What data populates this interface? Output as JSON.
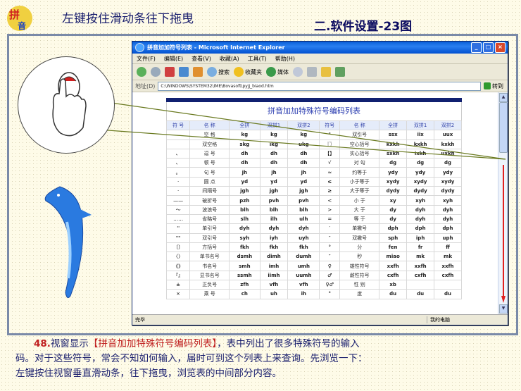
{
  "header": {
    "logo_text": "拼音",
    "left_title": "左键按住滑动条往下拖曳",
    "section_title": "二.软件设置-23图"
  },
  "window": {
    "title": "拼音加加符号列表 - Microsoft Internet Explorer",
    "menu": [
      "文件(F)",
      "编辑(E)",
      "查看(V)",
      "收藏(A)",
      "工具(T)",
      "帮助(H)"
    ],
    "toolbar": {
      "search": "搜索",
      "favorites": "收藏夹",
      "media": "媒体"
    },
    "address_label": "地址(D)",
    "address_value": "C:\\WINDOWS\\SYSTEM32\\IME\\Bovasoft\\pyjj_biaod.htm",
    "go_label": "转到",
    "status_left": "完毕",
    "status_right": "我的电脑"
  },
  "table": {
    "title": "拼音加加特殊符号编码列表",
    "headers": [
      "符 号",
      "名 称",
      "全拼",
      "双拼1",
      "双拼2",
      "符号",
      "名 称",
      "全拼",
      "双拼1",
      "双拼2"
    ],
    "rows": [
      [
        "",
        "空 格",
        "kg",
        "kg",
        "kg",
        "\"",
        "双引号",
        "ssx",
        "iix",
        "uux"
      ],
      [
        "",
        "双空格",
        "skg",
        "ikg",
        "ukg",
        "〖〗",
        "空心括号",
        "kxkh",
        "kxkh",
        "kxkh"
      ],
      [
        "、",
        "逗 号",
        "dh",
        "dh",
        "dh",
        "【】",
        "实心括号",
        "sxkh",
        "ixkh",
        "uxkh"
      ],
      [
        "、",
        "顿 号",
        "dh",
        "dh",
        "dh",
        "√",
        "对 勾",
        "dg",
        "dg",
        "dg"
      ],
      [
        "。",
        "句 号",
        "jh",
        "jh",
        "jh",
        "≈",
        "约等于",
        "ydy",
        "ydy",
        "ydy"
      ],
      [
        "·",
        "圆 点",
        "yd",
        "yd",
        "yd",
        "≤",
        "小于等于",
        "xydy",
        "xydy",
        "xydy"
      ],
      [
        "·",
        "间隔号",
        "jgh",
        "jgh",
        "jgh",
        "≥",
        "大于等于",
        "dydy",
        "dydy",
        "dydy"
      ],
      [
        "——",
        "破折号",
        "pzh",
        "pvh",
        "pvh",
        "<",
        "小 于",
        "xy",
        "xyh",
        "xyh"
      ],
      [
        "～",
        "波浪号",
        "blh",
        "blh",
        "blh",
        ">",
        "大 于",
        "dy",
        "dyh",
        "dyh"
      ],
      [
        "……",
        "省略号",
        "slh",
        "ilh",
        "ulh",
        "=",
        "等 于",
        "dy",
        "dyh",
        "dyh"
      ],
      [
        "''",
        "单引号",
        "dyh",
        "dyh",
        "dyh",
        "′",
        "单撇号",
        "dph",
        "dph",
        "dph"
      ],
      [
        "\"\"",
        "双引号",
        "syh",
        "iyh",
        "uyh",
        "″",
        "双撇号",
        "sph",
        "iph",
        "uph"
      ],
      [
        "〔〕",
        "方括号",
        "fkh",
        "fkh",
        "fkh",
        "°",
        "分",
        "fen",
        "fr",
        "ff"
      ],
      [
        "〈〉",
        "单书名号",
        "dsmh",
        "dimh",
        "dumh",
        "″",
        "秒",
        "miao",
        "mk",
        "mk"
      ],
      [
        "《》",
        "书名号",
        "smh",
        "imh",
        "umh",
        "♀",
        "雄性符号",
        "xxfh",
        "xxfh",
        "xxfh"
      ],
      [
        "『』",
        "显书名号",
        "ssmh",
        "iimh",
        "uumh",
        "♂",
        "雌性符号",
        "cxfh",
        "cxfh",
        "cxfh"
      ],
      [
        "±",
        "正负号",
        "zfh",
        "vfh",
        "vfh",
        "♀♂",
        "性 别",
        "xb",
        "",
        ""
      ],
      [
        "×",
        "乘 号",
        "ch",
        "uh",
        "ih",
        "°",
        "度",
        "du",
        "du",
        "du"
      ]
    ]
  },
  "caption": {
    "number": "48.",
    "line1_a": "视窗显示",
    "line1_highlight": "【拼音加加特殊符号编码列表】",
    "line1_b": "，表中列出了很多特殊符号的输入",
    "line2": "码。对于这些符号，常会不知如何输入，届时可到这个列表上来查询。先浏览一下：",
    "line3": "左键按住视窗垂直滑动条，往下拖曳，浏览表的中间部分内容。"
  },
  "colors": {
    "accent": "#c02020",
    "title_blue": "#1a1f6e",
    "xp_blue": "#0a5fd8"
  }
}
